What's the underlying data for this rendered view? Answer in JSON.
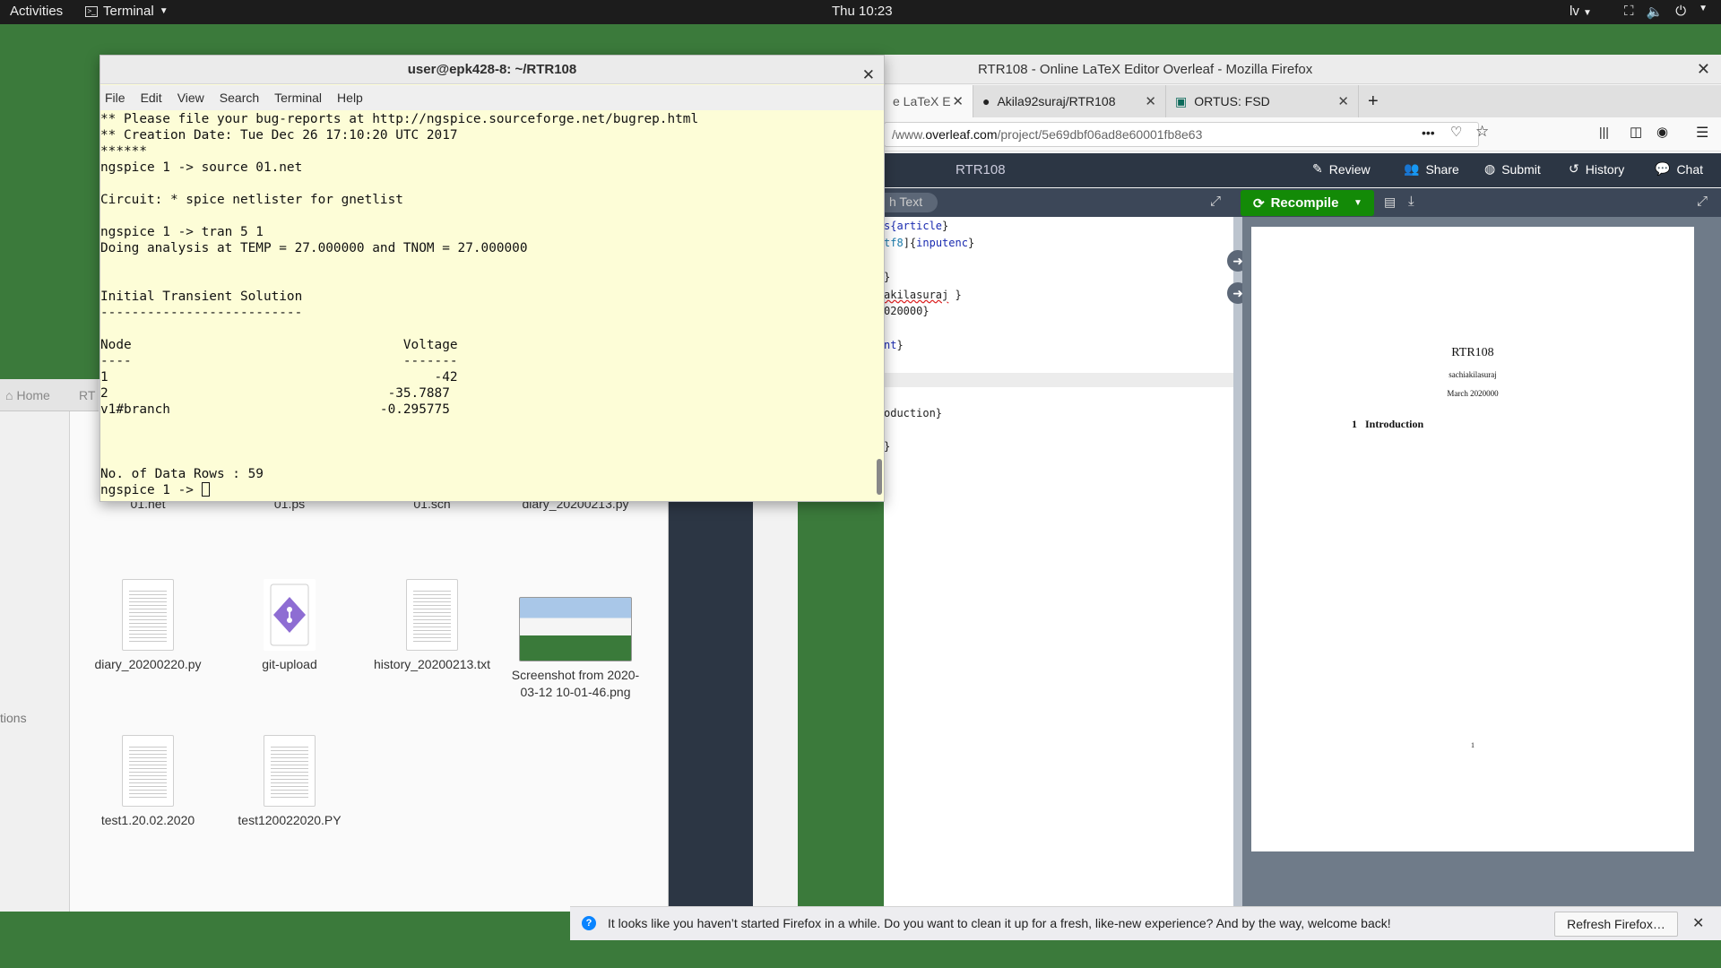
{
  "topbar": {
    "activities": "Activities",
    "app_name": "Terminal",
    "clock": "Thu 10:23",
    "language": "lv"
  },
  "terminal": {
    "title": "user@epk428-8: ~/RTR108",
    "menu": [
      "File",
      "Edit",
      "View",
      "Search",
      "Terminal",
      "Help"
    ],
    "lines": [
      "** Please file your bug-reports at http://ngspice.sourceforge.net/bugrep.html",
      "** Creation Date: Tue Dec 26 17:10:20 UTC 2017",
      "******",
      "ngspice 1 -> source 01.net",
      "",
      "Circuit: * spice netlister for gnetlist",
      "",
      "ngspice 1 -> tran 5 1",
      "Doing analysis at TEMP = 27.000000 and TNOM = 27.000000",
      "",
      "",
      "Initial Transient Solution",
      "--------------------------",
      "",
      "Node                                   Voltage",
      "----                                   -------",
      "1                                          -42",
      "2                                    -35.7887",
      "v1#branch                           -0.295775",
      "",
      "",
      "",
      "No. of Data Rows : 59"
    ],
    "prompt": "ngspice 1 -> "
  },
  "files": {
    "tab_home": "Home",
    "tab_other": "RT",
    "sidebar_label": "tions",
    "items": [
      {
        "name": "01.net"
      },
      {
        "name": "01.ps"
      },
      {
        "name": "01.sch"
      },
      {
        "name": "diary_20200213.py"
      },
      {
        "name": "diary_20200220.py"
      },
      {
        "name": "git-upload"
      },
      {
        "name": "history_20200213.txt"
      },
      {
        "name": "Screenshot from 2020-03-12 10-01-46.png"
      },
      {
        "name": "test1.20.02.2020"
      },
      {
        "name": "test120022020.PY"
      }
    ]
  },
  "firefox": {
    "window_title": "RTR108 - Online LaTeX Editor Overleaf - Mozilla Firefox",
    "tabs": [
      {
        "label": "e LaTeX E"
      },
      {
        "label": "Akila92suraj/RTR108"
      },
      {
        "label": "ORTUS: FSD"
      }
    ],
    "url_prefix": "/www.",
    "url_host": "overleaf.com",
    "url_path": "/project/5e69dbf06ad8e60001fb8e63",
    "notification": "It looks like you haven’t started Firefox in a while. Do you want to clean it up for a fresh, like-new experience? And by the way, welcome back!",
    "notification_button": "Refresh Firefox…"
  },
  "overleaf": {
    "project_name": "RTR108",
    "buttons": {
      "review": "Review",
      "share": "Share",
      "submit": "Submit",
      "history": "History",
      "chat": "Chat",
      "recompile": "Recompile",
      "rich_text": "h Text"
    },
    "editor": {
      "l1a": "s{",
      "l1b": "article",
      "l1c": "}",
      "l2a": "tf8",
      "l2b": "]{",
      "l2c": "inputenc",
      "l2d": "}",
      "l3": "}",
      "l4a": "akilasuraj",
      "l4b": " }",
      "l5": "020000}",
      "l6a": "nt",
      "l6b": "}",
      "l7": "oduction}",
      "l8": "}"
    },
    "pdf": {
      "title": "RTR108",
      "author": "sachiakilasuraj",
      "date": "March 2020000",
      "section_num": "1",
      "section_title": "Introduction",
      "page_number": "1"
    }
  }
}
